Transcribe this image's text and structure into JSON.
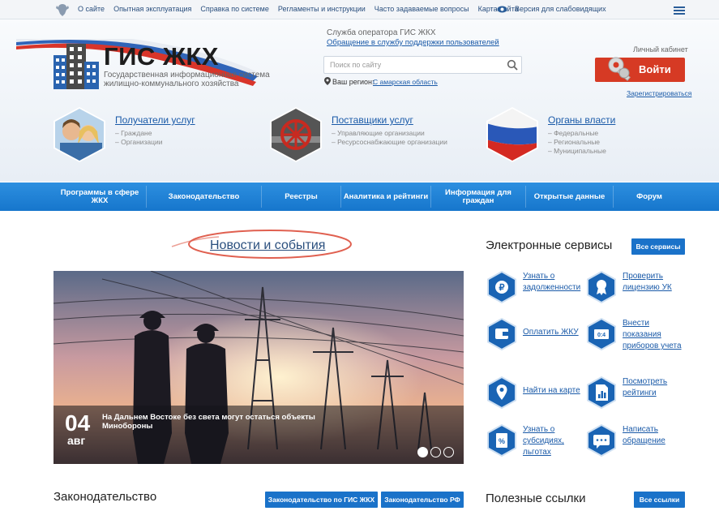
{
  "topbar": {
    "links": [
      "О сайте",
      "Опытная эксплуатация",
      "Справка по системе",
      "Регламенты и инструкции",
      "Часто задаваемые вопросы",
      "Карта сайта"
    ],
    "accessible_version": "Версия для слабовидящих"
  },
  "header": {
    "logo_title": "ГИС ЖКХ",
    "logo_subtitle": "Государственная информационная система жилищно-коммунального хозяйства",
    "operator": "Служба оператора ГИС ЖКХ",
    "support_link": "Обращение в службу поддержки пользователей",
    "search_placeholder": "Поиск по сайту",
    "region_label": "Ваш регион:",
    "region_value": "С амарская область",
    "cabinet_label": "Личный кабинет",
    "login_label": "Войти",
    "register_link": "Зарегистрироваться"
  },
  "groups": [
    {
      "title": "Получатели услуг",
      "items": [
        "– Граждане",
        "– Организации"
      ]
    },
    {
      "title": "Поставщики услуг",
      "items": [
        "– Управляющие организации",
        "– Ресурсоснабжающие организации"
      ]
    },
    {
      "title": "Органы власти",
      "items": [
        "– Федеральные",
        "– Региональные",
        "– Муниципальные"
      ]
    }
  ],
  "nav": [
    "Программы в сфере ЖКХ",
    "Законодательство",
    "Реестры",
    "Аналитика и рейтинги",
    "Информация для граждан",
    "Открытые данные",
    "Форум"
  ],
  "news": {
    "title": "Новости и события",
    "date_day": "04",
    "date_month": "авг",
    "caption": "На Дальнем Востоке без света могут остаться объекты Минобороны"
  },
  "services": {
    "title": "Электронные сервисы",
    "all_button": "Все сервисы",
    "items": [
      "Узнать о задолженности",
      "Проверить лицензию УК",
      "Оплатить ЖКУ",
      "Внести показания приборов учета",
      "Найти на карте",
      "Посмотреть рейтинги",
      "Узнать о субсидиях, льготах",
      "Написать обращение"
    ]
  },
  "legislation": {
    "title": "Законодательство",
    "btn_gis": "Законодательство по ГИС ЖКХ",
    "btn_rf": "Законодательство РФ"
  },
  "useful_links": {
    "title": "Полезные ссылки",
    "all_button": "Все ссылки"
  },
  "colors": {
    "nav_blue": "#1676cc",
    "login_red": "#d63a24",
    "icon_blue": "#1a64b4"
  }
}
